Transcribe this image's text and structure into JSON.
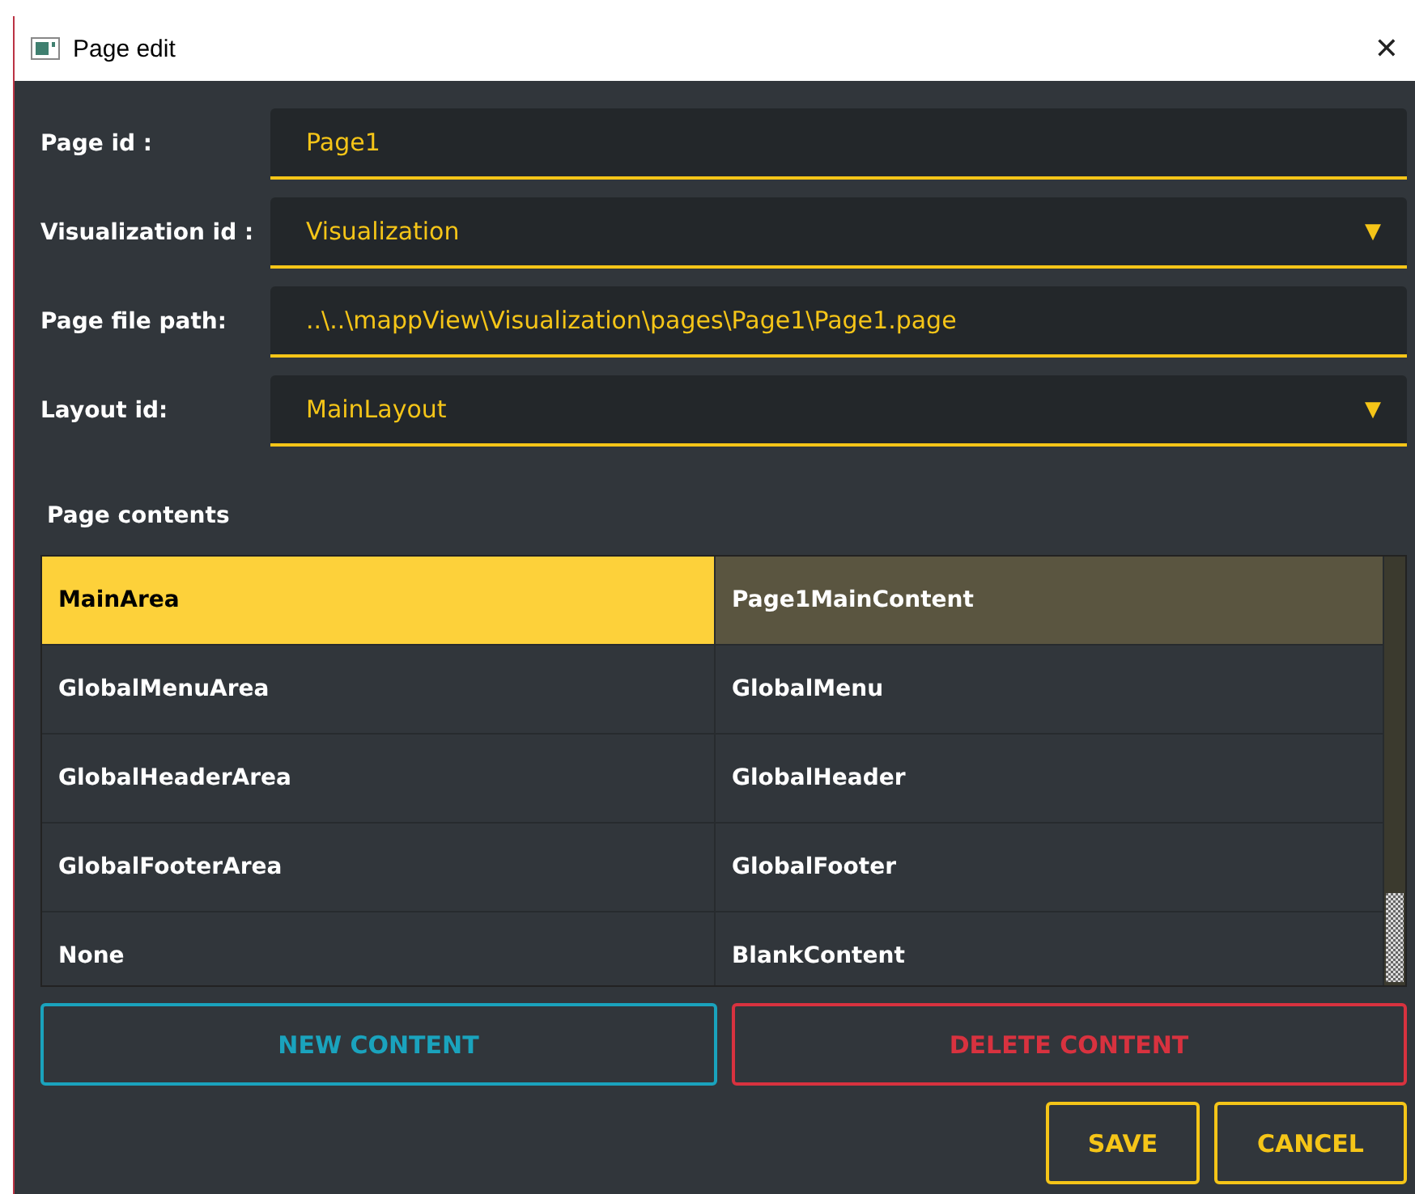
{
  "window": {
    "title": "Page edit",
    "close": "✕"
  },
  "fields": [
    {
      "label": "Page id :",
      "kind": "text",
      "value": "Page1"
    },
    {
      "label": "Visualization id :",
      "kind": "dropdown",
      "value": "Visualization",
      "arrow": "▼"
    },
    {
      "label": "Page file path:",
      "kind": "text",
      "value": "..\\..\\mappView\\Visualization\\pages\\Page1\\Page1.page"
    },
    {
      "label": "Layout id:",
      "kind": "dropdown",
      "value": "MainLayout",
      "arrow": "▼"
    }
  ],
  "contents": {
    "title": "Page contents",
    "rows": [
      {
        "area": "MainArea",
        "content": "Page1MainContent",
        "selected": true
      },
      {
        "area": "GlobalMenuArea",
        "content": "GlobalMenu",
        "selected": false
      },
      {
        "area": "GlobalHeaderArea",
        "content": "GlobalHeader",
        "selected": false
      },
      {
        "area": "GlobalFooterArea",
        "content": "GlobalFooter",
        "selected": false
      },
      {
        "area": "None",
        "content": "BlankContent",
        "selected": false
      }
    ]
  },
  "buttons": [
    {
      "label": "NEW CONTENT",
      "kind": "new"
    },
    {
      "label": "DELETE CONTENT",
      "kind": "delete"
    },
    {
      "label": "SAVE",
      "kind": "save"
    },
    {
      "label": "CANCEL",
      "kind": "cancel"
    }
  ]
}
